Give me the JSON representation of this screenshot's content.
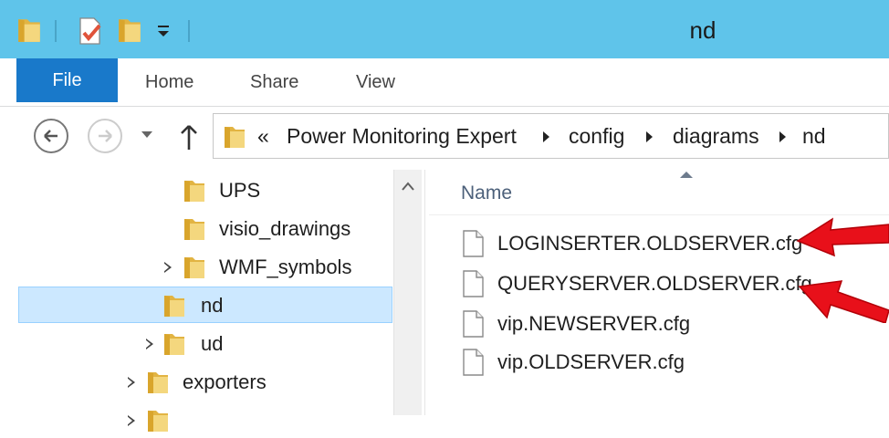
{
  "window": {
    "title": "nd"
  },
  "ribbon": {
    "tabs": [
      "File",
      "Home",
      "Share",
      "View"
    ]
  },
  "address": {
    "overflow": "«",
    "crumbs": [
      "Power Monitoring Expert",
      "config",
      "diagrams",
      "nd"
    ]
  },
  "nav_tree": {
    "items": [
      {
        "label": "UPS",
        "expandable": false
      },
      {
        "label": "visio_drawings",
        "expandable": false
      },
      {
        "label": "WMF_symbols",
        "expandable": true
      },
      {
        "label": "nd",
        "expandable": false,
        "selected": true
      },
      {
        "label": "ud",
        "expandable": true
      },
      {
        "label": "exporters",
        "expandable": true
      }
    ]
  },
  "content": {
    "column_name": "Name",
    "files": [
      {
        "name": "LOGINSERTER.OLDSERVER.cfg",
        "highlighted": true
      },
      {
        "name": "QUERYSERVER.OLDSERVER.cfg",
        "highlighted": true
      },
      {
        "name": "vip.NEWSERVER.cfg",
        "highlighted": false
      },
      {
        "name": "vip.OLDSERVER.cfg",
        "highlighted": false
      }
    ]
  },
  "colors": {
    "titlebar": "#5fc4ea",
    "file_tab": "#1979ca",
    "selection": "#cce8ff",
    "annotation_arrow": "#e8101a",
    "folder": "#e8c25a"
  },
  "icons": {
    "folder": "folder-icon",
    "file": "file-icon",
    "back": "back-arrow-icon",
    "forward": "forward-arrow-icon",
    "up": "up-arrow-icon"
  }
}
